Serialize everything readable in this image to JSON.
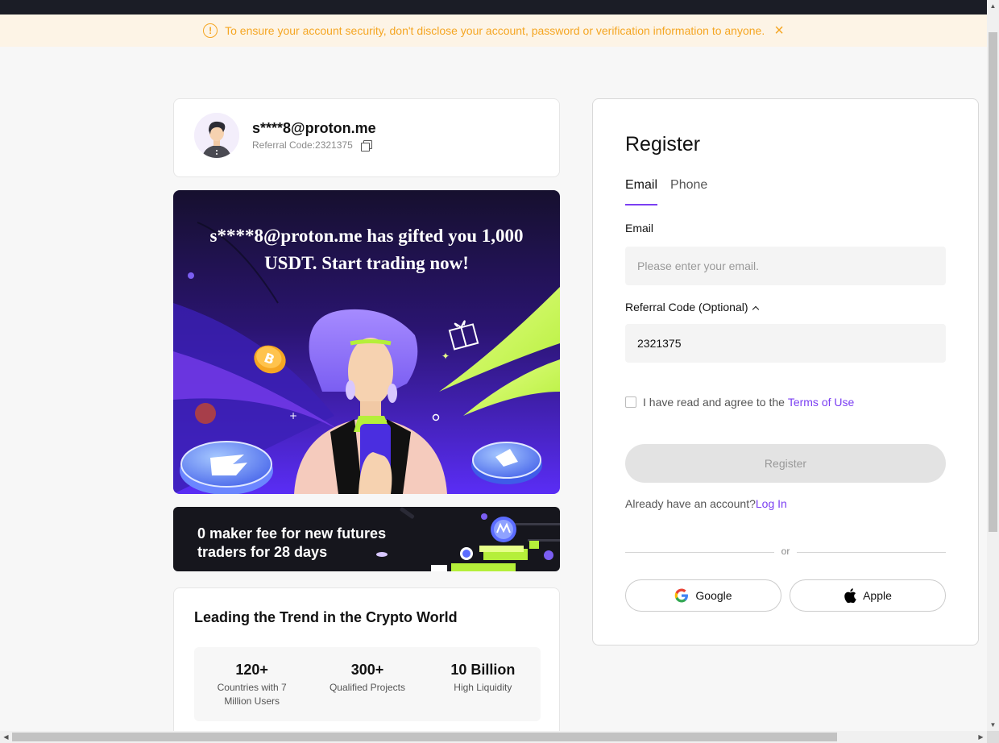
{
  "notice": {
    "text": "To ensure your account security, don't disclose your account, password or verification information to anyone.",
    "warning_glyph": "!",
    "close_glyph": "×"
  },
  "profile": {
    "email": "s****8@proton.me",
    "referral_label": "Referral Code:2321375"
  },
  "banner": {
    "headline": "s****8@proton.me has gifted you 1,000 USDT. Start trading now!"
  },
  "promo": {
    "text": "0 maker fee for new futures traders for 28 days"
  },
  "stats": {
    "title": "Leading the Trend in the Crypto World",
    "items": [
      {
        "value": "120+",
        "caption": "Countries with 7 Million Users"
      },
      {
        "value": "300+",
        "caption": "Qualified Projects"
      },
      {
        "value": "10 Billion",
        "caption": "High Liquidity"
      }
    ]
  },
  "register": {
    "title": "Register",
    "tabs": [
      {
        "label": "Email",
        "active": true
      },
      {
        "label": "Phone",
        "active": false
      }
    ],
    "email_label": "Email",
    "email_placeholder": "Please enter your email.",
    "email_value": "",
    "referral_label": "Referral Code (Optional)",
    "referral_value": "2321375",
    "agree_text": "I have read and agree to the",
    "terms_link": "Terms of Use",
    "agree_checked": false,
    "submit_label": "Register",
    "already_text": "Already have an account?",
    "login_link": "Log In",
    "or_text": "or",
    "google_label": "Google",
    "apple_label": "Apple"
  },
  "colors": {
    "accent": "#7b3ff2",
    "notice_text": "#f5a623",
    "notice_bg": "#fdf4e6",
    "topbar": "#1b1d26"
  },
  "icons": [
    "warning-icon",
    "close-icon",
    "copy-icon",
    "chevron-up-icon",
    "google-icon",
    "apple-icon"
  ]
}
